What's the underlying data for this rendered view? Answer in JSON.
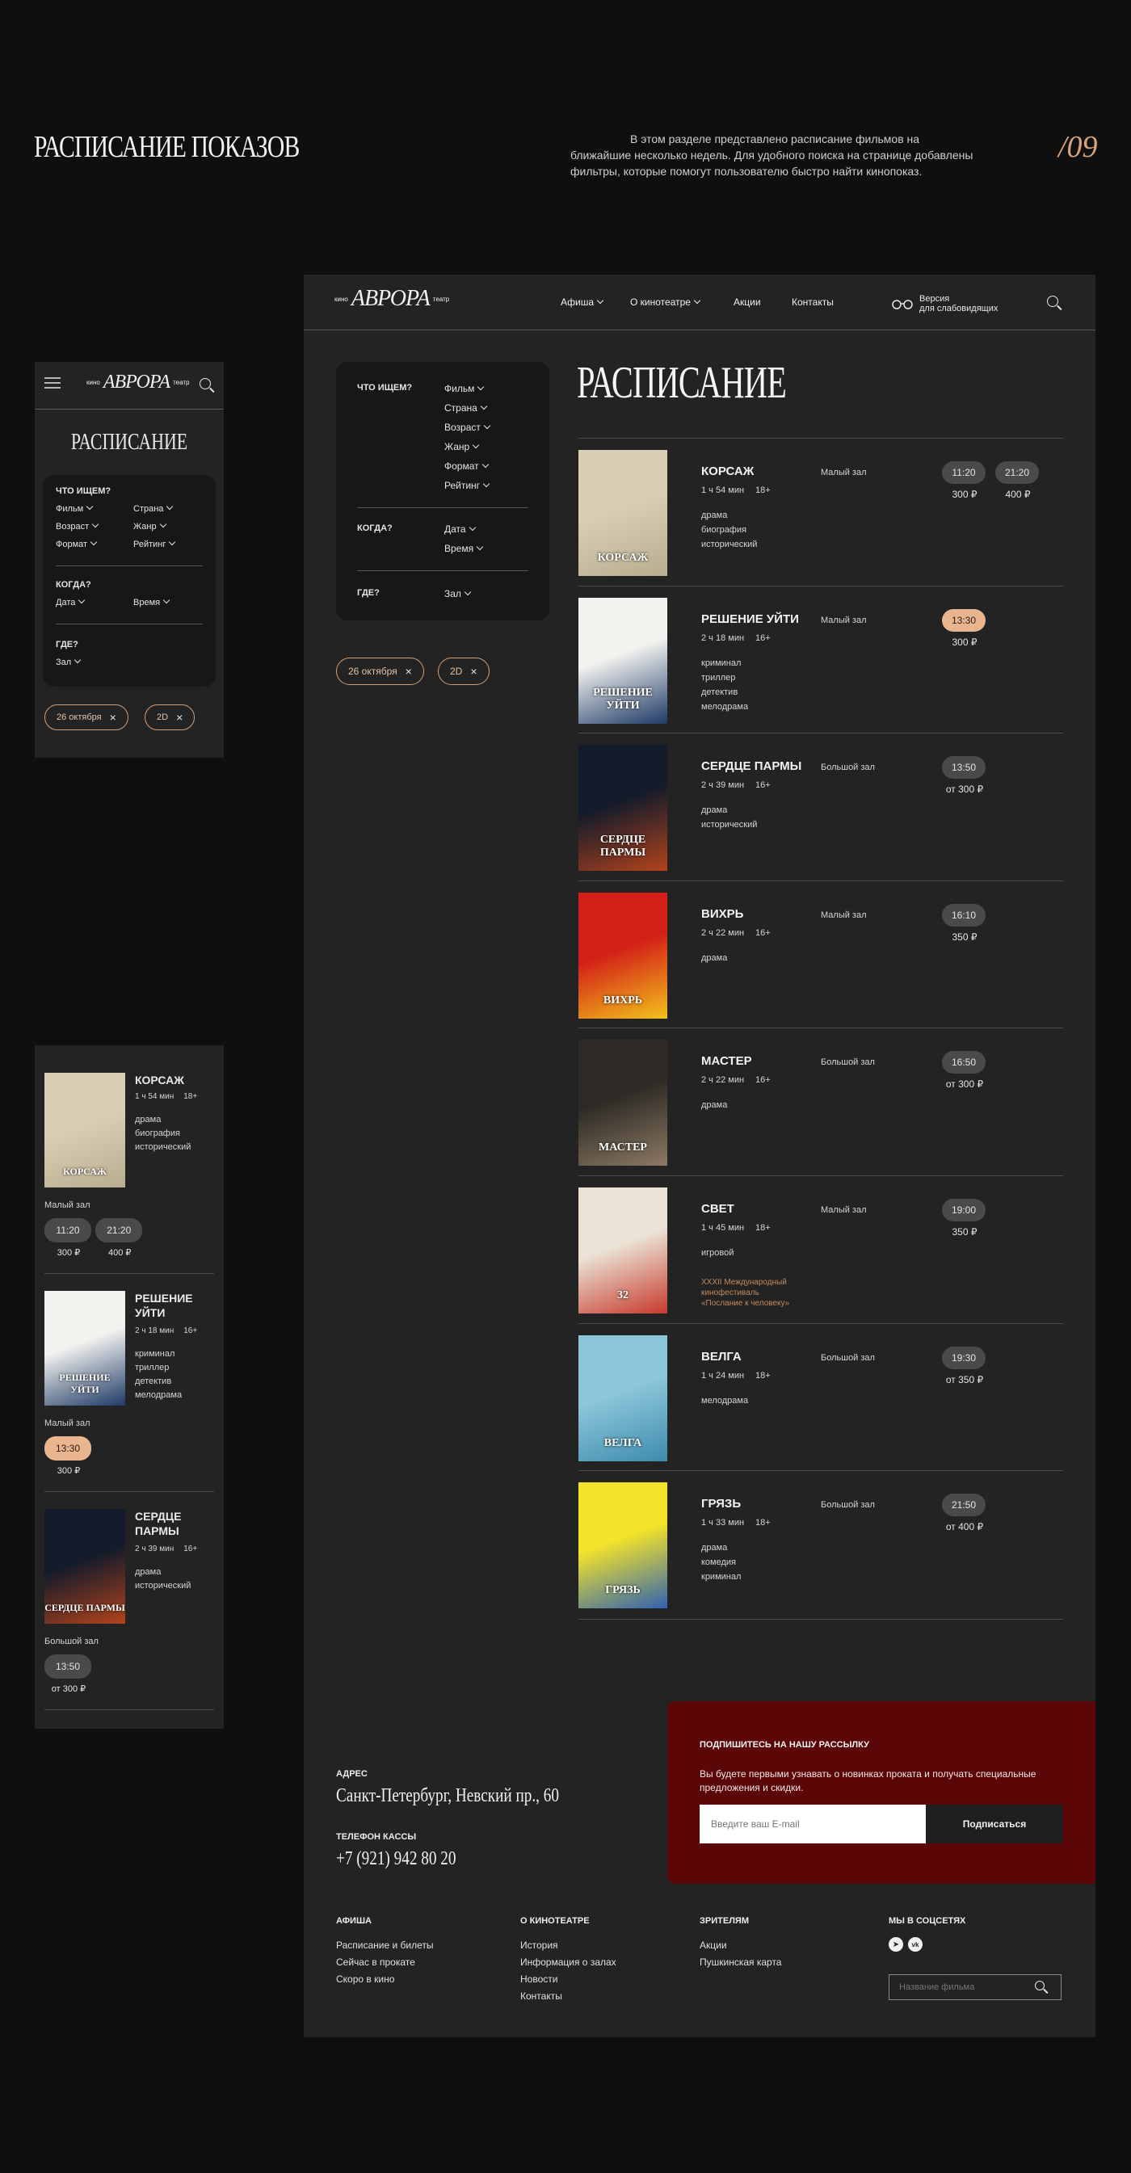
{
  "header": {
    "title": "РАСПИСАНИЕ ПОКАЗОВ",
    "description": "В этом разделе представлено расписание фильмов на ближайшие несколько недель. Для удобного поиска на странице добавлены фильтры, которые помогут пользователю быстро найти кинопоказ.",
    "page_number": "/09"
  },
  "logo": {
    "small_left": "кино",
    "main": "АВРОРА",
    "small_right": "театр"
  },
  "nav": {
    "items": [
      {
        "label": "Афиша"
      },
      {
        "label": "О кинотеатре"
      },
      {
        "label": "Акции"
      },
      {
        "label": "Контакты"
      }
    ],
    "accessibility_label": "Версия\nдля слабовидящих"
  },
  "schedule_title": "РАСПИСАНИЕ",
  "filters": {
    "what_label": "ЧТО ИЩЕМ?",
    "what_options": [
      "Фильм",
      "Страна",
      "Возраст",
      "Жанр",
      "Формат",
      "Рейтинг"
    ],
    "when_label": "КОГДА?",
    "when_options": [
      "Дата",
      "Время"
    ],
    "where_label": "ГДЕ?",
    "where_options": [
      "Зал"
    ]
  },
  "chips": [
    {
      "label": "26 октября"
    },
    {
      "label": "2D"
    }
  ],
  "movies": [
    {
      "title": "КОРСАЖ",
      "duration": "1 ч 54 мин",
      "age": "18+",
      "genres": "драма\nбиография\nисторический",
      "hall": "Малый зал",
      "slots": [
        {
          "time": "11:20",
          "price": "300 ₽",
          "active": false
        },
        {
          "time": "21:20",
          "price": "400 ₽",
          "active": false
        }
      ],
      "poster_colors": [
        "#d8cfb4",
        "#b9ad8f"
      ],
      "poster_text": "КОРСАЖ"
    },
    {
      "title": "РЕШЕНИЕ УЙТИ",
      "duration": "2 ч 18 мин",
      "age": "16+",
      "genres": "криминал\nтриллер\nдетектив\nмелодрама",
      "hall": "Малый зал",
      "slots": [
        {
          "time": "13:30",
          "price": "300 ₽",
          "active": true
        }
      ],
      "poster_colors": [
        "#f2f2ef",
        "#1e3a66"
      ],
      "poster_text": "РЕШЕНИЕ УЙТИ"
    },
    {
      "title": "СЕРДЦЕ ПАРМЫ",
      "duration": "2 ч 39 мин",
      "age": "16+",
      "genres": "драма\nисторический",
      "hall": "Большой зал",
      "slots": [
        {
          "time": "13:50",
          "price": "от 300 ₽",
          "active": false
        }
      ],
      "poster_colors": [
        "#141b2a",
        "#b3431c"
      ],
      "poster_text": "СЕРДЦЕ ПАРМЫ"
    },
    {
      "title": "ВИХРЬ",
      "duration": "2 ч 22 мин",
      "age": "16+",
      "genres": "драма",
      "hall": "Малый зал",
      "slots": [
        {
          "time": "16:10",
          "price": "350 ₽",
          "active": false
        }
      ],
      "poster_colors": [
        "#d32018",
        "#f2c21a"
      ],
      "poster_text": "ВИХРЬ"
    },
    {
      "title": "МАСТЕР",
      "duration": "2 ч 22 мин",
      "age": "16+",
      "genres": "драма",
      "hall": "Большой зал",
      "slots": [
        {
          "time": "16:50",
          "price": "от 300 ₽",
          "active": false
        }
      ],
      "poster_colors": [
        "#2e2b26",
        "#8c7a63"
      ],
      "poster_text": "МАСТЕР"
    },
    {
      "title": "СВЕТ",
      "duration": "1 ч 45 мин",
      "age": "18+",
      "genres": "игровой",
      "festival": "XXXII Международный кинофестиваль «Послание к человеку»",
      "hall": "Малый зал",
      "slots": [
        {
          "time": "19:00",
          "price": "350 ₽",
          "active": false
        }
      ],
      "poster_colors": [
        "#ebe4d6",
        "#c73a2c"
      ],
      "poster_text": "32"
    },
    {
      "title": "ВЕЛГА",
      "duration": "1 ч 24 мин",
      "age": "18+",
      "genres": "мелодрама",
      "hall": "Большой зал",
      "slots": [
        {
          "time": "19:30",
          "price": "от 350 ₽",
          "active": false
        }
      ],
      "poster_colors": [
        "#8cc6da",
        "#3d8cad"
      ],
      "poster_text": "ВЕЛГА"
    },
    {
      "title": "ГРЯЗЬ",
      "duration": "1 ч 33 мин",
      "age": "18+",
      "genres": "драма\nкомедия\nкриминал",
      "hall": "Большой зал",
      "slots": [
        {
          "time": "21:50",
          "price": "от 400 ₽",
          "active": false
        }
      ],
      "poster_colors": [
        "#f3e32a",
        "#2f63b0"
      ],
      "poster_text": "ГРЯЗЬ"
    }
  ],
  "footer": {
    "address_label": "АДРЕС",
    "address": "Санкт-Петербург, Невский пр., 60",
    "phone_label": "ТЕЛЕФОН КАССЫ",
    "phone": "+7 (921) 942 80 20",
    "subscribe_title": "ПОДПИШИТЕСЬ НА НАШУ РАССЫЛКУ",
    "subscribe_text": "Вы будете первыми узнавать о новинках проката и получать специальные предложения и скидки.",
    "email_placeholder": "Введите ваш E-mail",
    "subscribe_button": "Подписаться",
    "columns": [
      {
        "title": "АФИША",
        "links": [
          "Расписание и билеты",
          "Сейчас в прокате",
          "Скоро в кино"
        ]
      },
      {
        "title": "О КИНОТЕАТРЕ",
        "links": [
          "История",
          "Информация о залах",
          "Новости",
          "Контакты"
        ]
      },
      {
        "title": "ЗРИТЕЛЯМ",
        "links": [
          "Акции",
          "Пушкинская карта"
        ]
      }
    ],
    "social_title": "МЫ В СОЦСЕТЯХ",
    "search_placeholder": "Название фильма"
  },
  "mobile": {
    "title": "РАСПИСАНИЕ",
    "what_options": [
      "Фильм",
      "Страна",
      "Возраст",
      "Жанр",
      "Формат",
      "Рейтинг"
    ]
  }
}
